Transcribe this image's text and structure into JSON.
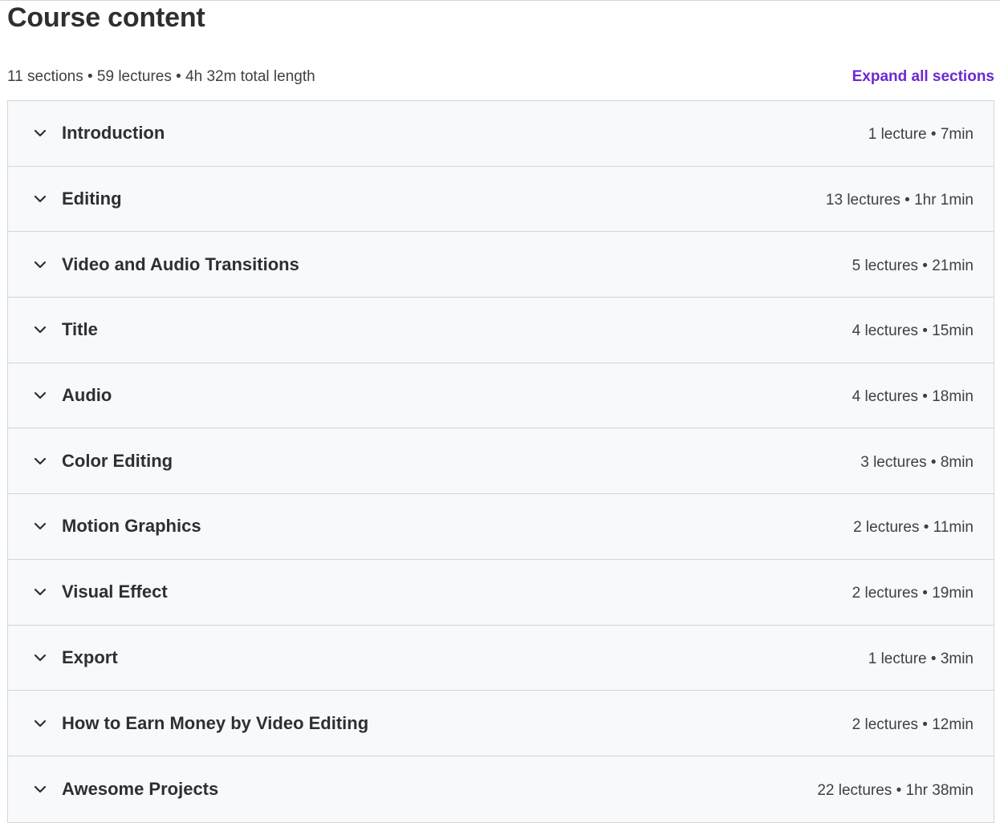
{
  "course": {
    "title": "Course content",
    "summary": "11 sections • 59 lectures • 4h 32m total length",
    "expand_label": "Expand all sections"
  },
  "colors": {
    "accent": "#6d28d2",
    "row_background": "#f7f9fa",
    "border": "#d1d7dc",
    "text": "#2d2f31"
  },
  "icons": {
    "section_toggle": "chevron-down-icon"
  },
  "sections": [
    {
      "title": "Introduction",
      "meta": "1 lecture • 7min"
    },
    {
      "title": "Editing",
      "meta": "13 lectures • 1hr 1min"
    },
    {
      "title": "Video and Audio Transitions",
      "meta": "5 lectures • 21min"
    },
    {
      "title": "Title",
      "meta": "4 lectures • 15min"
    },
    {
      "title": "Audio",
      "meta": "4 lectures • 18min"
    },
    {
      "title": "Color Editing",
      "meta": "3 lectures • 8min"
    },
    {
      "title": "Motion Graphics",
      "meta": "2 lectures • 11min"
    },
    {
      "title": "Visual Effect",
      "meta": "2 lectures • 19min"
    },
    {
      "title": "Export",
      "meta": "1 lecture • 3min"
    },
    {
      "title": "How to Earn Money by Video Editing",
      "meta": "2 lectures • 12min"
    },
    {
      "title": "Awesome Projects",
      "meta": "22 lectures • 1hr 38min"
    }
  ]
}
